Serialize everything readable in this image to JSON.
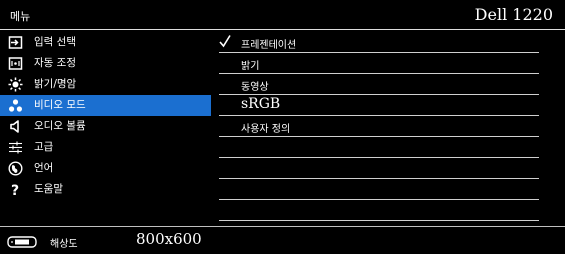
{
  "title_bar": {
    "menu_label": "메뉴",
    "model": "Dell 1220"
  },
  "sidebar": {
    "items": [
      {
        "label": "입력 선택",
        "icon": "input-icon"
      },
      {
        "label": "자동 조정",
        "icon": "auto-adjust-icon"
      },
      {
        "label": "밝기/명암",
        "icon": "brightness-icon"
      },
      {
        "label": "비디오 모드",
        "icon": "video-mode-icon",
        "selected": true
      },
      {
        "label": "오디오 볼륨",
        "icon": "speaker-icon"
      },
      {
        "label": "고급",
        "icon": "sliders-icon"
      },
      {
        "label": "언어",
        "icon": "globe-icon"
      },
      {
        "label": "도움말",
        "icon": "help-icon"
      }
    ]
  },
  "options": [
    {
      "label": "프레젠테이션",
      "checked": true
    },
    {
      "label": "밝기"
    },
    {
      "label": "동영상"
    },
    {
      "label": "sRGB"
    },
    {
      "label": "사용자 정의"
    },
    {
      "label": ""
    },
    {
      "label": ""
    },
    {
      "label": ""
    },
    {
      "label": ""
    }
  ],
  "status": {
    "resolution_label": "해상도",
    "resolution_value": "800x600",
    "icon": "monitor-icon"
  },
  "colors": {
    "background": "#000000",
    "highlight": "#1b6fd0",
    "text": "#ffffff",
    "divider": "#cfcfcf"
  }
}
